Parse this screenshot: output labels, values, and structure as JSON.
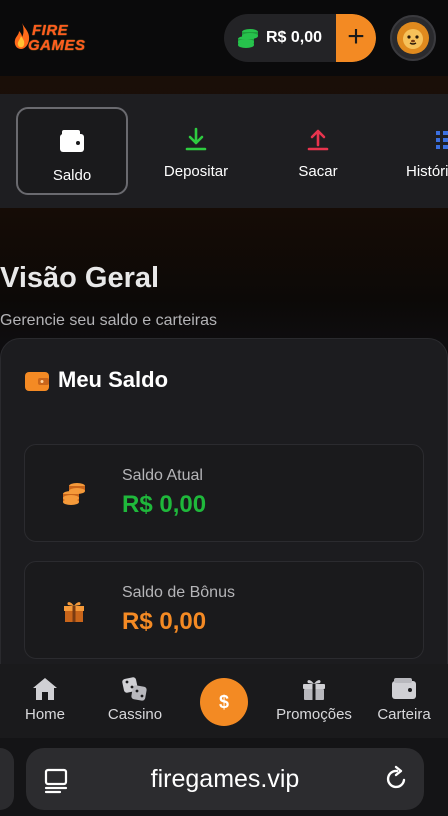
{
  "header": {
    "logo_line1": "FIRE",
    "logo_line2": "GAMES",
    "balance": "R$ 0,00",
    "add_label": "+"
  },
  "tabs": [
    {
      "label": "Saldo",
      "icon": "wallet-icon",
      "active": true
    },
    {
      "label": "Depositar",
      "icon": "download-icon",
      "active": false
    },
    {
      "label": "Sacar",
      "icon": "upload-icon",
      "active": false
    },
    {
      "label": "Históri",
      "icon": "list-icon",
      "active": false
    }
  ],
  "overview": {
    "title": "Visão Geral",
    "subtitle": "Gerencie seu saldo e carteiras"
  },
  "wallet_card": {
    "title": "Meu Saldo",
    "current": {
      "label": "Saldo Atual",
      "value": "R$ 0,00"
    },
    "bonus": {
      "label": "Saldo de Bônus",
      "value": "R$ 0,00"
    }
  },
  "bottom_nav": {
    "home": "Home",
    "casino": "Cassino",
    "center": "$",
    "promotions": "Promoções",
    "wallet": "Carteira"
  },
  "browser": {
    "url": "firegames.vip"
  },
  "colors": {
    "accent": "#f38a23",
    "green": "#1fb83b",
    "tab_green": "#2ecc40",
    "tab_red": "#e8344e",
    "tab_blue": "#3b6fe0"
  }
}
